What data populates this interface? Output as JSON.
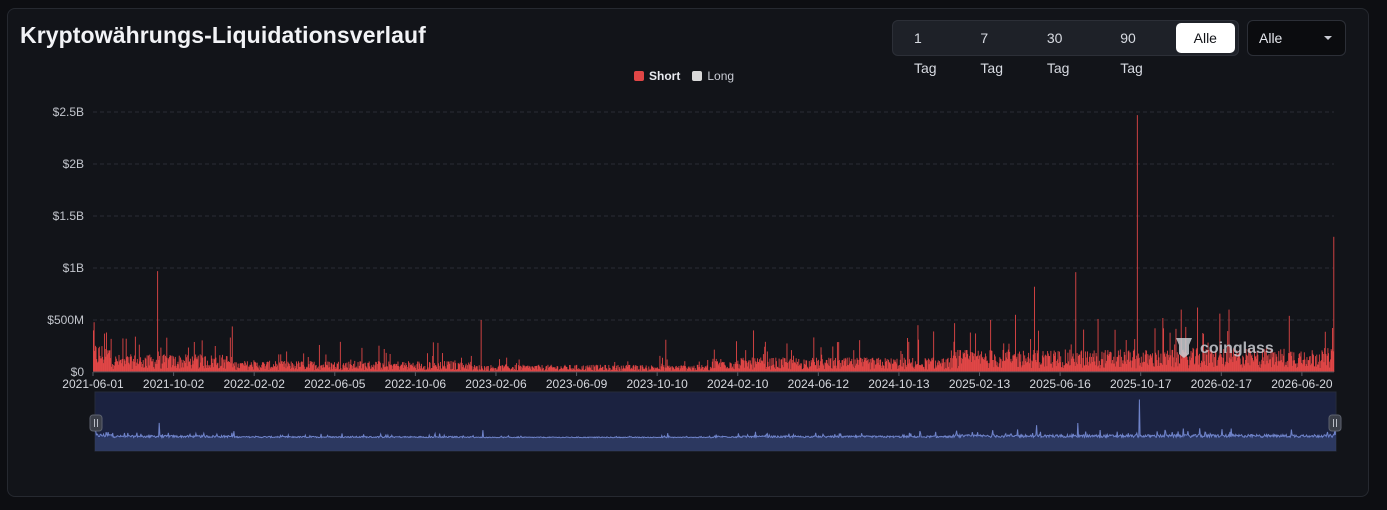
{
  "header": {
    "title": "Kryptowährungs-Liquidationsverlauf"
  },
  "range_buttons": [
    {
      "label": "1 Tag",
      "active": false
    },
    {
      "label": "7 Tag",
      "active": false
    },
    {
      "label": "30 Tag",
      "active": false
    },
    {
      "label": "90 Tag",
      "active": false
    },
    {
      "label": "Alle",
      "active": true
    }
  ],
  "select": {
    "value": "Alle"
  },
  "watermark": "coinglass",
  "colors": {
    "short": "#e04646",
    "long": "#d9d9d9",
    "grid": "#2a2d35",
    "overview_fill": "#1b2240",
    "overview_line": "#6f83c9"
  },
  "chart_data": {
    "type": "bar",
    "stacked": true,
    "legend": [
      {
        "name": "Short",
        "color": "#e04646",
        "selected": true
      },
      {
        "name": "Long",
        "color": "#d9d9d9",
        "selected": false
      }
    ],
    "legend_position": "top-center",
    "grid": true,
    "ylim": [
      0,
      2500000000
    ],
    "y_ticks": [
      "$0",
      "$500M",
      "$1B",
      "$1.5B",
      "$2B",
      "$2.5B"
    ],
    "x_ticks": [
      "2021-06-01",
      "2021-10-02",
      "2022-02-02",
      "2022-06-05",
      "2022-10-06",
      "2023-02-06",
      "2023-06-09",
      "2023-10-10",
      "2024-02-10",
      "2024-06-12",
      "2024-10-13",
      "2025-02-13",
      "2025-06-16",
      "2025-10-17",
      "2026-02-17",
      "2026-06-20"
    ],
    "x_range": [
      "2021-06-01",
      "2026-08-08"
    ],
    "baseline_short_by_period": [
      {
        "period": "2021-06",
        "typical": 180000000
      },
      {
        "period": "2021-H2",
        "typical": 110000000
      },
      {
        "period": "2022",
        "typical": 70000000
      },
      {
        "period": "2023",
        "typical": 45000000
      },
      {
        "period": "2024",
        "typical": 90000000
      },
      {
        "period": "2025",
        "typical": 140000000
      },
      {
        "period": "2026",
        "typical": 150000000
      }
    ],
    "notable_values": [
      {
        "date": "2021-06-01",
        "short": 400000000
      },
      {
        "date": "2021-06-21",
        "short": 380000000
      },
      {
        "date": "2021-07-21",
        "short": 320000000
      },
      {
        "date": "2021-08-04",
        "short": 340000000
      },
      {
        "date": "2021-09-07",
        "short": 970000000
      },
      {
        "date": "2021-09-21",
        "short": 330000000
      },
      {
        "date": "2021-12-04",
        "short": 250000000
      },
      {
        "date": "2022-05-12",
        "short": 260000000
      },
      {
        "date": "2022-06-13",
        "short": 290000000
      },
      {
        "date": "2022-11-09",
        "short": 280000000
      },
      {
        "date": "2023-01-14",
        "short": 500000000
      },
      {
        "date": "2023-03-13",
        "short": 120000000
      },
      {
        "date": "2023-10-23",
        "short": 310000000
      },
      {
        "date": "2024-03-05",
        "short": 400000000
      },
      {
        "date": "2024-08-05",
        "short": 210000000
      },
      {
        "date": "2024-11-11",
        "short": 450000000
      },
      {
        "date": "2024-12-05",
        "short": 390000000
      },
      {
        "date": "2025-03-02",
        "short": 500000000
      },
      {
        "date": "2025-04-09",
        "short": 550000000
      },
      {
        "date": "2025-05-08",
        "short": 820000000
      },
      {
        "date": "2025-07-10",
        "short": 960000000
      },
      {
        "date": "2025-08-13",
        "short": 510000000
      },
      {
        "date": "2025-10-12",
        "short": 2470000000
      },
      {
        "date": "2025-11-21",
        "short": 420000000
      },
      {
        "date": "2025-12-18",
        "short": 600000000
      },
      {
        "date": "2026-01-12",
        "short": 620000000
      },
      {
        "date": "2026-03-01",
        "short": 600000000
      },
      {
        "date": "2026-06-01",
        "short": 540000000
      },
      {
        "date": "2026-08-08",
        "short": 1300000000
      }
    ]
  }
}
